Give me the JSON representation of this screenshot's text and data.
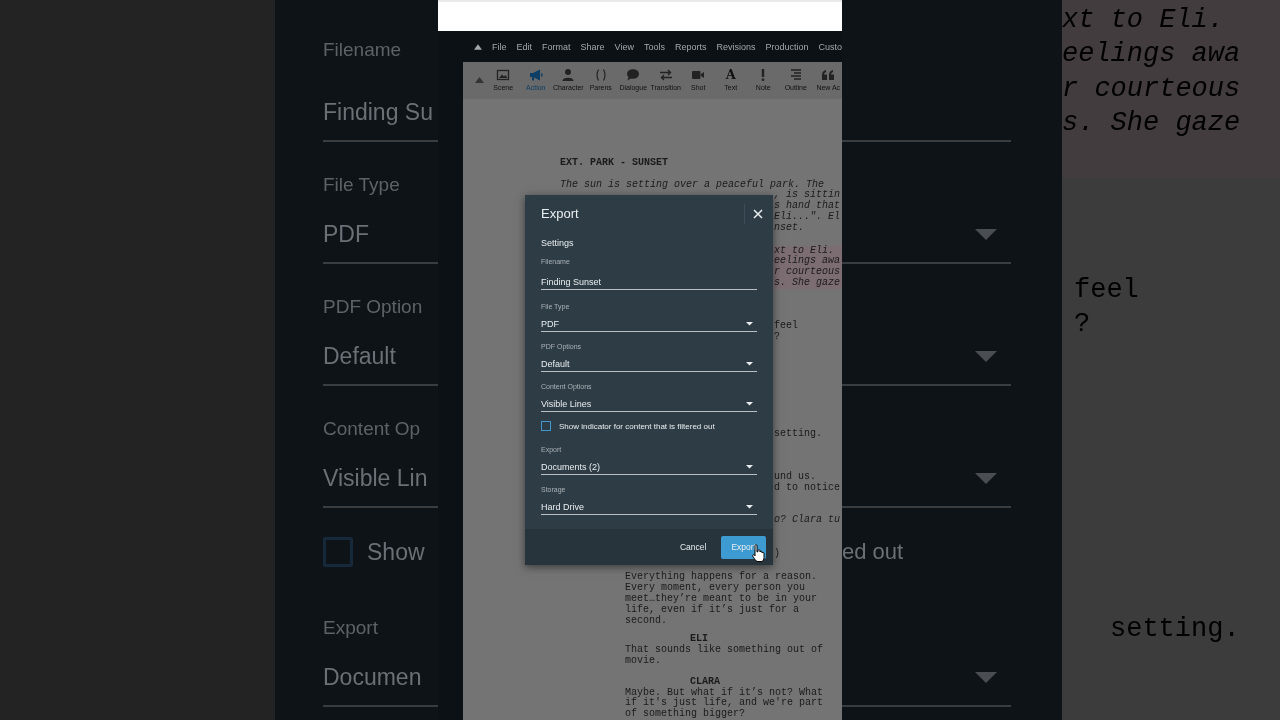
{
  "background_left": {
    "fields": [
      {
        "kind": "input",
        "label": "Filename",
        "value": "Finding Su"
      },
      {
        "kind": "select",
        "label": "File Type",
        "value": "PDF"
      },
      {
        "kind": "select",
        "label": "PDF Option",
        "value": "Default"
      },
      {
        "kind": "select",
        "label": "Content Op",
        "value": "Visible Lin"
      },
      {
        "kind": "checkbox",
        "label": "Show",
        "checked": false
      },
      {
        "kind": "select",
        "label": "Export",
        "value": "Documen"
      }
    ]
  },
  "app": {
    "menu": [
      "File",
      "Edit",
      "Format",
      "Share",
      "View",
      "Tools",
      "Reports",
      "Revisions",
      "Production",
      "Custo"
    ],
    "toolbar": [
      {
        "label": "Scene",
        "selected": false
      },
      {
        "label": "Action",
        "selected": true
      },
      {
        "label": "Character",
        "selected": false
      },
      {
        "label": "Parens",
        "selected": false
      },
      {
        "label": "Dialogue",
        "selected": false
      },
      {
        "label": "Transition",
        "selected": false
      },
      {
        "label": "Shot",
        "selected": false
      },
      {
        "label": "Text",
        "selected": false,
        "glyph": "A"
      },
      {
        "label": "Note",
        "selected": false
      },
      {
        "label": "Outline",
        "selected": false
      },
      {
        "label": "New Ac",
        "selected": false
      }
    ],
    "script": [
      {
        "kind": "heading",
        "lines": [
          "EXT. PARK - SUNSET"
        ]
      },
      {
        "kind": "action",
        "lines": [
          "The sun is setting over a peaceful park. The"
        ]
      },
      {
        "kind": "action",
        "covered": true,
        "lines": [
          ", is sittin",
          "s hand that",
          "Eli...\". El",
          "nset."
        ]
      },
      {
        "kind": "action",
        "covered": true,
        "highlighted": true,
        "lines": [
          "xt to Eli.",
          "eelings awa",
          "r courteous",
          "s. She gaze"
        ]
      },
      {
        "kind": "dialogue",
        "covered": true,
        "lines": [
          "feel",
          "?"
        ]
      },
      {
        "kind": "dialogue",
        "covered": true,
        "lines": [
          "setting."
        ]
      },
      {
        "kind": "dialogue",
        "covered": true,
        "lines": [
          "und us.",
          "d to notice"
        ]
      },
      {
        "kind": "action",
        "covered": true,
        "lines": [
          "o? Clara tu"
        ]
      },
      {
        "kind": "parenthetical",
        "covered": true,
        "lines": [
          ")"
        ]
      },
      {
        "kind": "dialogue",
        "lines": [
          "Everything happens for a reason.",
          "Every moment, every person you",
          "meet…they’re meant to be in your",
          "life, even if it’s just for a",
          "second."
        ]
      },
      {
        "kind": "character",
        "lines": [
          "ELI"
        ]
      },
      {
        "kind": "dialogue",
        "lines": [
          "That sounds like something out of",
          "movie."
        ]
      },
      {
        "kind": "character",
        "lines": [
          "CLARA"
        ]
      },
      {
        "kind": "dialogue",
        "lines": [
          "Maybe. But what if it’s not? What",
          "if it's just life, and we're part",
          "of something bigger?"
        ]
      }
    ]
  },
  "dialog": {
    "title": "Export",
    "section": "Settings",
    "fields": [
      {
        "kind": "input",
        "label": "Filename",
        "value": "Finding Sunset"
      },
      {
        "kind": "select",
        "label": "File Type",
        "value": "PDF"
      },
      {
        "kind": "select",
        "label": "PDF Options",
        "value": "Default"
      },
      {
        "kind": "select",
        "label": "Content Options",
        "value": "Visible Lines"
      },
      {
        "kind": "checkbox",
        "label": "Show indicator for content that is filtered out",
        "checked": false
      },
      {
        "kind": "select",
        "label": "Export",
        "value": "Documents (2)"
      },
      {
        "kind": "select",
        "label": "Storage",
        "value": "Hard Drive"
      }
    ],
    "buttons": [
      {
        "kind": "secondary",
        "label": "Cancel"
      },
      {
        "kind": "primary",
        "label": "Export"
      }
    ]
  },
  "background_right": {
    "fields": [
      {
        "kind": "input"
      },
      {
        "kind": "select"
      },
      {
        "kind": "select"
      },
      {
        "kind": "select"
      },
      {
        "kind": "checkbox",
        "label": "ed out"
      },
      {
        "kind": "select"
      }
    ]
  },
  "background_script": [
    {
      "kind": "action",
      "highlighted": true,
      "lines": [
        "xt to Eli.",
        "eelings awa",
        "r courteous",
        "s. She gaze"
      ]
    },
    {
      "kind": "dialogue",
      "lines": [
        "feel",
        "?"
      ]
    },
    {
      "kind": "dialogue",
      "lines": [
        "setting."
      ]
    }
  ]
}
